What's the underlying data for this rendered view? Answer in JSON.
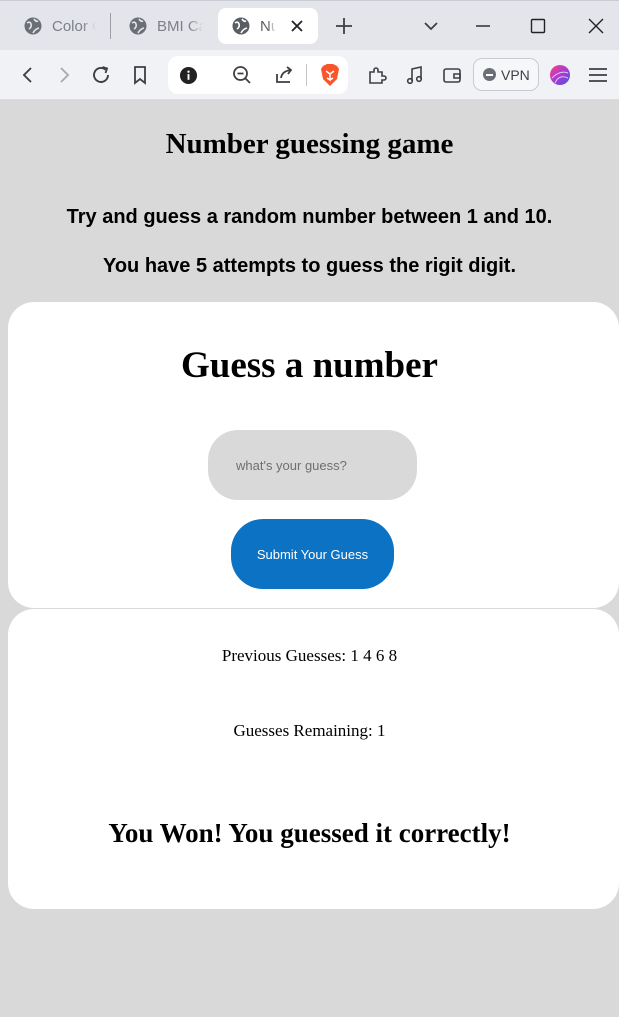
{
  "browser": {
    "tabs": [
      {
        "title": "Color C",
        "icon": "globe-icon",
        "active": false
      },
      {
        "title": "BMI Ca",
        "icon": "globe-icon",
        "active": false
      },
      {
        "title": "Nu",
        "icon": "globe-icon",
        "active": true
      }
    ],
    "vpn_label": "VPN"
  },
  "page": {
    "title": "Number guessing game",
    "intro_line1": "Try and guess a random number between 1 and 10.",
    "intro_line2": "You have 5 attempts to guess the rigit digit."
  },
  "form": {
    "heading": "Guess a number",
    "input_placeholder": "what's your guess?",
    "input_value": "",
    "submit_label": "Submit Your Guess"
  },
  "results": {
    "previous_guesses_label": "Previous Guesses:",
    "previous_guesses_values": "1 4 6 8",
    "remaining_label": "Guesses Remaining:",
    "remaining_value": "1",
    "message": "You Won! You guessed it correctly!"
  },
  "colors": {
    "page_background": "#d9d9d9",
    "card_background": "#ffffff",
    "input_background": "#d9d9d9",
    "submit_button": "#0b72c4",
    "brave_orange": "#fb542b"
  }
}
